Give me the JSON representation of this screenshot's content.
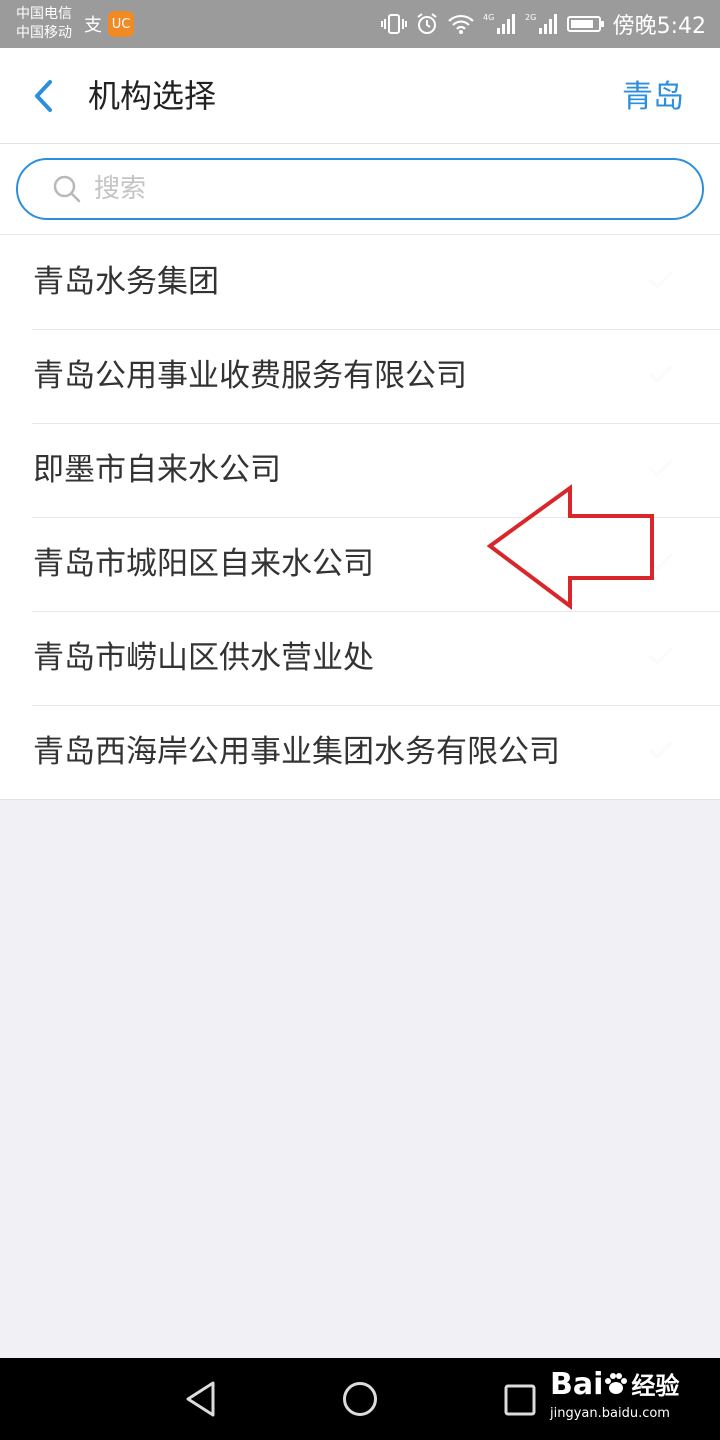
{
  "status_bar": {
    "carrier_1": "中国电信",
    "carrier_2": "中国移动",
    "time": "傍晚5:42",
    "network_1": "4G",
    "network_2": "2G",
    "icons": [
      "alipay-icon",
      "uc-browser-icon",
      "vibrate-icon",
      "alarm-icon",
      "wifi-icon",
      "signal-icon",
      "battery-icon"
    ]
  },
  "header": {
    "title": "机构选择",
    "city": "青岛",
    "accent_color": "#2d8fdc"
  },
  "search": {
    "placeholder": "搜索",
    "value": ""
  },
  "organizations": [
    {
      "label": "青岛水务集团"
    },
    {
      "label": "青岛公用事业收费服务有限公司"
    },
    {
      "label": "即墨市自来水公司"
    },
    {
      "label": "青岛市城阳区自来水公司"
    },
    {
      "label": "青岛市崂山区供水营业处"
    },
    {
      "label": "青岛西海岸公用事业集团水务有限公司"
    }
  ],
  "annotation": {
    "type": "arrow-left",
    "points_to": "青岛市城阳区自来水公司",
    "color": "#d9262b"
  },
  "watermark": {
    "brand": "Bai",
    "brand_cn": "经验",
    "url": "jingyan.baidu.com"
  }
}
